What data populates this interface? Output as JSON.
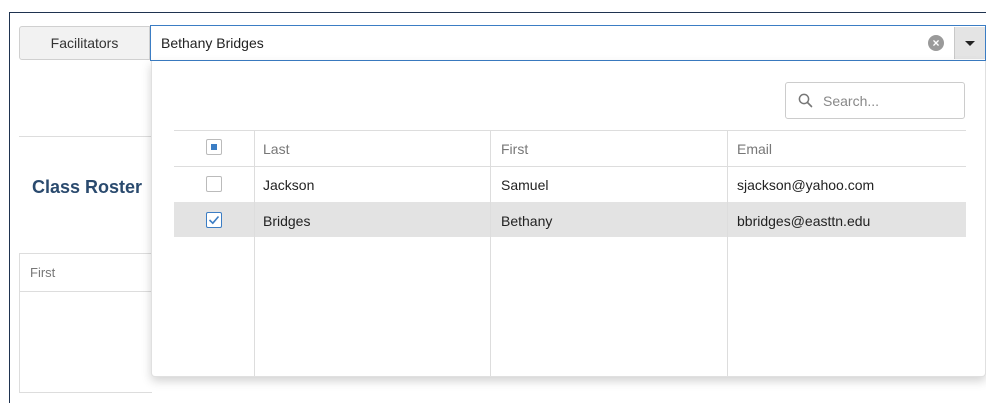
{
  "facilitators_label": "Facilitators",
  "selected_value": "Bethany Bridges",
  "search": {
    "placeholder": "Search..."
  },
  "roster_title": "Class Roster",
  "left_table_header": "First",
  "columns": [
    "Last",
    "First",
    "Email"
  ],
  "rows": [
    {
      "last": "Jackson",
      "first": "Samuel",
      "email": "sjackson@yahoo.com",
      "checked": false
    },
    {
      "last": "Bridges",
      "first": "Bethany",
      "email": "bbridges@easttn.edu",
      "checked": true
    }
  ],
  "colors": {
    "accent": "#3b7dc4",
    "title": "#2a4a6e",
    "selected_row": "#e3e3e3"
  },
  "icons": [
    "clear-icon",
    "caret-down-icon",
    "search-icon",
    "checkbox-icon"
  ]
}
